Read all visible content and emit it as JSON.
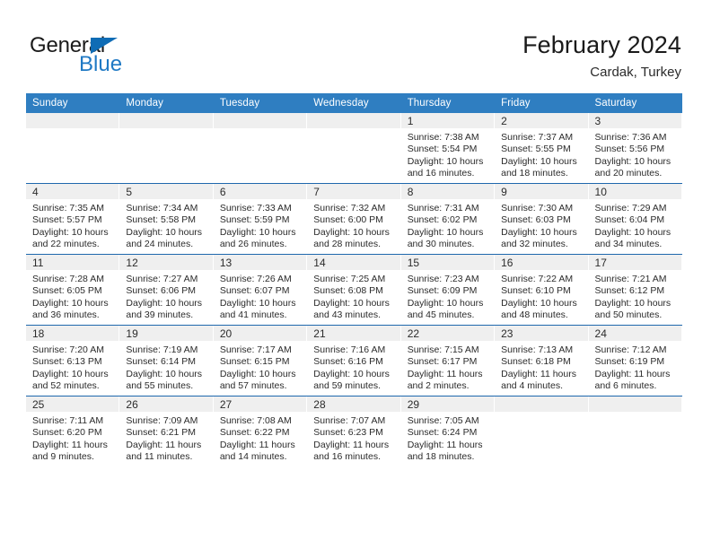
{
  "brand": {
    "word_one": "General",
    "word_two": "Blue"
  },
  "header": {
    "title": "February 2024",
    "subtitle": "Cardak, Turkey"
  },
  "calendar": {
    "weekday_headers": [
      "Sunday",
      "Monday",
      "Tuesday",
      "Wednesday",
      "Thursday",
      "Friday",
      "Saturday"
    ],
    "colors": {
      "header_blue": "#2f7ec1",
      "row_rule_blue": "#1f68ad",
      "daynum_strip": "#efefef",
      "brand_blue": "#1f79c4"
    },
    "weeks": [
      [
        {
          "day": "",
          "empty": true
        },
        {
          "day": "",
          "empty": true
        },
        {
          "day": "",
          "empty": true
        },
        {
          "day": "",
          "empty": true
        },
        {
          "day": "1",
          "sunrise": "Sunrise: 7:38 AM",
          "sunset": "Sunset: 5:54 PM",
          "daylight_1": "Daylight: 10 hours",
          "daylight_2": "and 16 minutes."
        },
        {
          "day": "2",
          "sunrise": "Sunrise: 7:37 AM",
          "sunset": "Sunset: 5:55 PM",
          "daylight_1": "Daylight: 10 hours",
          "daylight_2": "and 18 minutes."
        },
        {
          "day": "3",
          "sunrise": "Sunrise: 7:36 AM",
          "sunset": "Sunset: 5:56 PM",
          "daylight_1": "Daylight: 10 hours",
          "daylight_2": "and 20 minutes."
        }
      ],
      [
        {
          "day": "4",
          "sunrise": "Sunrise: 7:35 AM",
          "sunset": "Sunset: 5:57 PM",
          "daylight_1": "Daylight: 10 hours",
          "daylight_2": "and 22 minutes."
        },
        {
          "day": "5",
          "sunrise": "Sunrise: 7:34 AM",
          "sunset": "Sunset: 5:58 PM",
          "daylight_1": "Daylight: 10 hours",
          "daylight_2": "and 24 minutes."
        },
        {
          "day": "6",
          "sunrise": "Sunrise: 7:33 AM",
          "sunset": "Sunset: 5:59 PM",
          "daylight_1": "Daylight: 10 hours",
          "daylight_2": "and 26 minutes."
        },
        {
          "day": "7",
          "sunrise": "Sunrise: 7:32 AM",
          "sunset": "Sunset: 6:00 PM",
          "daylight_1": "Daylight: 10 hours",
          "daylight_2": "and 28 minutes."
        },
        {
          "day": "8",
          "sunrise": "Sunrise: 7:31 AM",
          "sunset": "Sunset: 6:02 PM",
          "daylight_1": "Daylight: 10 hours",
          "daylight_2": "and 30 minutes."
        },
        {
          "day": "9",
          "sunrise": "Sunrise: 7:30 AM",
          "sunset": "Sunset: 6:03 PM",
          "daylight_1": "Daylight: 10 hours",
          "daylight_2": "and 32 minutes."
        },
        {
          "day": "10",
          "sunrise": "Sunrise: 7:29 AM",
          "sunset": "Sunset: 6:04 PM",
          "daylight_1": "Daylight: 10 hours",
          "daylight_2": "and 34 minutes."
        }
      ],
      [
        {
          "day": "11",
          "sunrise": "Sunrise: 7:28 AM",
          "sunset": "Sunset: 6:05 PM",
          "daylight_1": "Daylight: 10 hours",
          "daylight_2": "and 36 minutes."
        },
        {
          "day": "12",
          "sunrise": "Sunrise: 7:27 AM",
          "sunset": "Sunset: 6:06 PM",
          "daylight_1": "Daylight: 10 hours",
          "daylight_2": "and 39 minutes."
        },
        {
          "day": "13",
          "sunrise": "Sunrise: 7:26 AM",
          "sunset": "Sunset: 6:07 PM",
          "daylight_1": "Daylight: 10 hours",
          "daylight_2": "and 41 minutes."
        },
        {
          "day": "14",
          "sunrise": "Sunrise: 7:25 AM",
          "sunset": "Sunset: 6:08 PM",
          "daylight_1": "Daylight: 10 hours",
          "daylight_2": "and 43 minutes."
        },
        {
          "day": "15",
          "sunrise": "Sunrise: 7:23 AM",
          "sunset": "Sunset: 6:09 PM",
          "daylight_1": "Daylight: 10 hours",
          "daylight_2": "and 45 minutes."
        },
        {
          "day": "16",
          "sunrise": "Sunrise: 7:22 AM",
          "sunset": "Sunset: 6:10 PM",
          "daylight_1": "Daylight: 10 hours",
          "daylight_2": "and 48 minutes."
        },
        {
          "day": "17",
          "sunrise": "Sunrise: 7:21 AM",
          "sunset": "Sunset: 6:12 PM",
          "daylight_1": "Daylight: 10 hours",
          "daylight_2": "and 50 minutes."
        }
      ],
      [
        {
          "day": "18",
          "sunrise": "Sunrise: 7:20 AM",
          "sunset": "Sunset: 6:13 PM",
          "daylight_1": "Daylight: 10 hours",
          "daylight_2": "and 52 minutes."
        },
        {
          "day": "19",
          "sunrise": "Sunrise: 7:19 AM",
          "sunset": "Sunset: 6:14 PM",
          "daylight_1": "Daylight: 10 hours",
          "daylight_2": "and 55 minutes."
        },
        {
          "day": "20",
          "sunrise": "Sunrise: 7:17 AM",
          "sunset": "Sunset: 6:15 PM",
          "daylight_1": "Daylight: 10 hours",
          "daylight_2": "and 57 minutes."
        },
        {
          "day": "21",
          "sunrise": "Sunrise: 7:16 AM",
          "sunset": "Sunset: 6:16 PM",
          "daylight_1": "Daylight: 10 hours",
          "daylight_2": "and 59 minutes."
        },
        {
          "day": "22",
          "sunrise": "Sunrise: 7:15 AM",
          "sunset": "Sunset: 6:17 PM",
          "daylight_1": "Daylight: 11 hours",
          "daylight_2": "and 2 minutes."
        },
        {
          "day": "23",
          "sunrise": "Sunrise: 7:13 AM",
          "sunset": "Sunset: 6:18 PM",
          "daylight_1": "Daylight: 11 hours",
          "daylight_2": "and 4 minutes."
        },
        {
          "day": "24",
          "sunrise": "Sunrise: 7:12 AM",
          "sunset": "Sunset: 6:19 PM",
          "daylight_1": "Daylight: 11 hours",
          "daylight_2": "and 6 minutes."
        }
      ],
      [
        {
          "day": "25",
          "sunrise": "Sunrise: 7:11 AM",
          "sunset": "Sunset: 6:20 PM",
          "daylight_1": "Daylight: 11 hours",
          "daylight_2": "and 9 minutes."
        },
        {
          "day": "26",
          "sunrise": "Sunrise: 7:09 AM",
          "sunset": "Sunset: 6:21 PM",
          "daylight_1": "Daylight: 11 hours",
          "daylight_2": "and 11 minutes."
        },
        {
          "day": "27",
          "sunrise": "Sunrise: 7:08 AM",
          "sunset": "Sunset: 6:22 PM",
          "daylight_1": "Daylight: 11 hours",
          "daylight_2": "and 14 minutes."
        },
        {
          "day": "28",
          "sunrise": "Sunrise: 7:07 AM",
          "sunset": "Sunset: 6:23 PM",
          "daylight_1": "Daylight: 11 hours",
          "daylight_2": "and 16 minutes."
        },
        {
          "day": "29",
          "sunrise": "Sunrise: 7:05 AM",
          "sunset": "Sunset: 6:24 PM",
          "daylight_1": "Daylight: 11 hours",
          "daylight_2": "and 18 minutes."
        },
        {
          "day": "",
          "empty": true
        },
        {
          "day": "",
          "empty": true
        }
      ]
    ]
  }
}
